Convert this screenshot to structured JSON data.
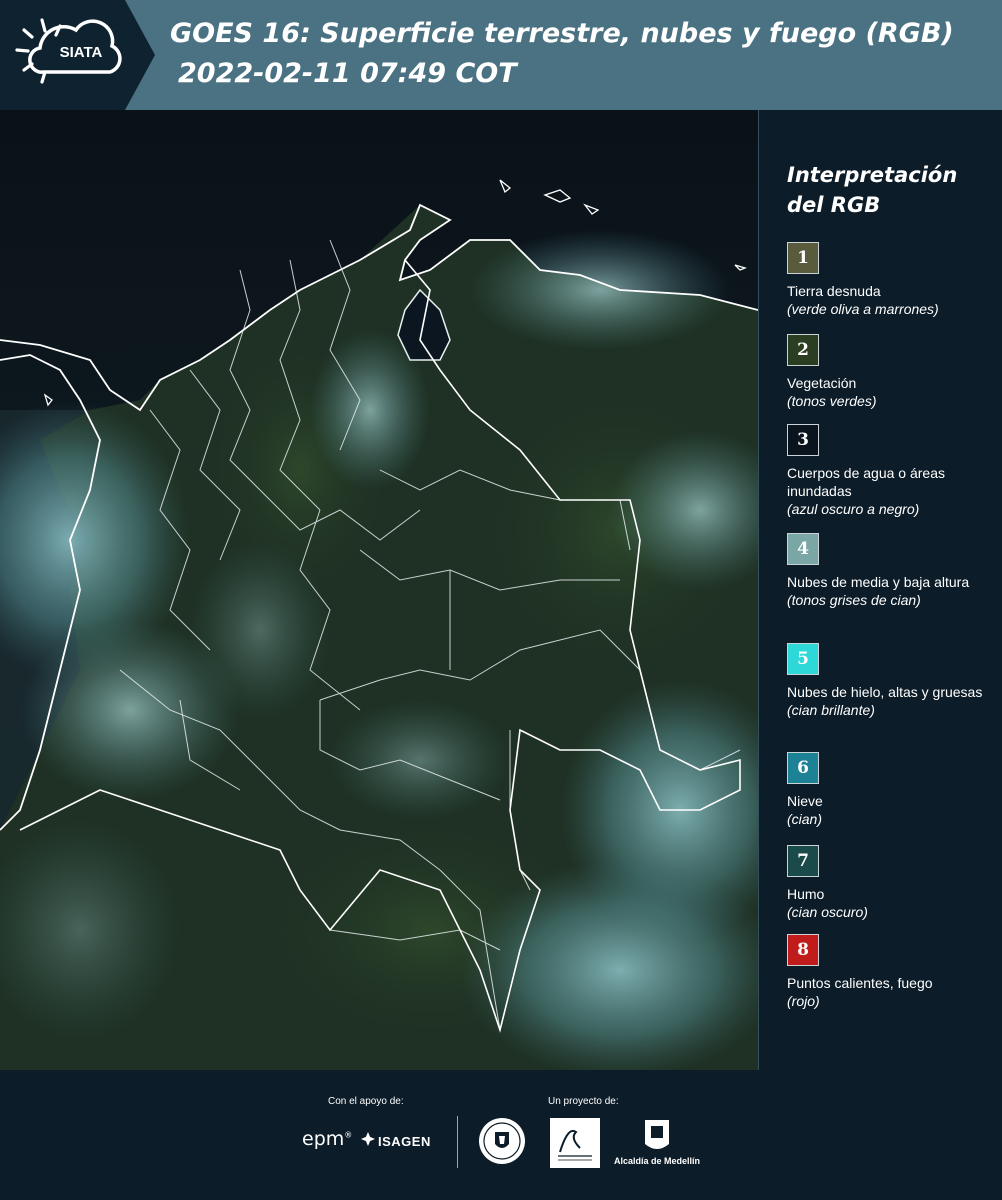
{
  "header": {
    "logo_text": "SIATA",
    "title": "GOES 16: Superficie terrestre, nubes y fuego (RGB)",
    "timestamp": "2022-02-11 07:49 COT"
  },
  "legend": {
    "title_line1": "Interpretación",
    "title_line2": "del RGB",
    "items": [
      {
        "number": "1",
        "color": "#5a5a3c",
        "name": "Tierra desnuda",
        "desc": "(verde oliva a marrones)"
      },
      {
        "number": "2",
        "color": "#2c3e22",
        "name": "Vegetación",
        "desc": "(tonos verdes)"
      },
      {
        "number": "3",
        "color": "#0a141e",
        "name": "Cuerpos de agua o áreas inundadas",
        "desc": "(azul oscuro a negro)"
      },
      {
        "number": "4",
        "color": "#7aa6a6",
        "name": "Nubes de media y baja altura",
        "desc": "(tonos grises de cian)"
      },
      {
        "number": "5",
        "color": "#2ed8d8",
        "name": "Nubes de hielo, altas y gruesas",
        "desc": "(cian brillante)"
      },
      {
        "number": "6",
        "color": "#1e8296",
        "name": "Nieve",
        "desc": "(cian)"
      },
      {
        "number": "7",
        "color": "#1a4a4a",
        "name": "Humo",
        "desc": "(cian oscuro)"
      },
      {
        "number": "8",
        "color": "#c01c1c",
        "name": "Puntos calientes, fuego",
        "desc": "(rojo)"
      }
    ]
  },
  "footer": {
    "support_label": "Con el apoyo de:",
    "project_label": "Un proyecto de:",
    "epm": "epm",
    "isagen": "ISAGEN",
    "alcaldia": "Alcaldía de Medellín"
  }
}
